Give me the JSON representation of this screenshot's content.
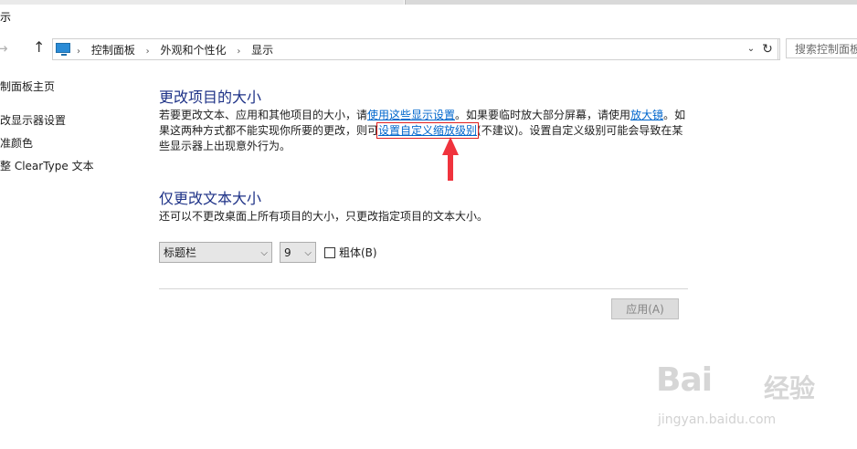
{
  "window": {
    "title": "示"
  },
  "nav": {
    "back_icon": "back-arrow-icon",
    "forward_icon": "forward-arrow-icon",
    "up_icon": "up-arrow-icon",
    "breadcrumb": [
      "控制面板",
      "外观和个性化",
      "显示"
    ],
    "search_placeholder": "搜索控制面板"
  },
  "sidebar": {
    "items": [
      {
        "label": "制面板主页"
      },
      {
        "label": "改显示器设置"
      },
      {
        "label": "准颜色"
      },
      {
        "label": "整 ClearType 文本"
      }
    ]
  },
  "section1": {
    "heading": "更改项目的大小",
    "text_a": "若要更改文本、应用和其他项目的大小，请",
    "link_a": "使用这些显示设置",
    "text_b": "。如果要临时放大部分屏幕，请使用",
    "link_b": "放大镜",
    "text_c": "。如果这两种方式都不能实现你所要的更改，则可",
    "link_c": "设置自定义缩放级别",
    "text_d": "(不建议)。设置自定义级别可能会导致在某些显示器上出现意外行为。"
  },
  "section2": {
    "heading": "仅更改文本大小",
    "description": "还可以不更改桌面上所有项目的大小，只更改指定项目的文本大小。",
    "item_select": "标题栏",
    "size_select": "9",
    "bold_label": "粗体(B)",
    "bold_checked": false
  },
  "apply_button": "应用(A)",
  "watermark": {
    "brand": "Bai",
    "brand_cn": "经验",
    "url": "jingyan.baidu.com"
  },
  "colors": {
    "heading": "#1e3287",
    "link": "#0066cc",
    "highlight": "#e02020",
    "arrow": "#f0333d"
  }
}
